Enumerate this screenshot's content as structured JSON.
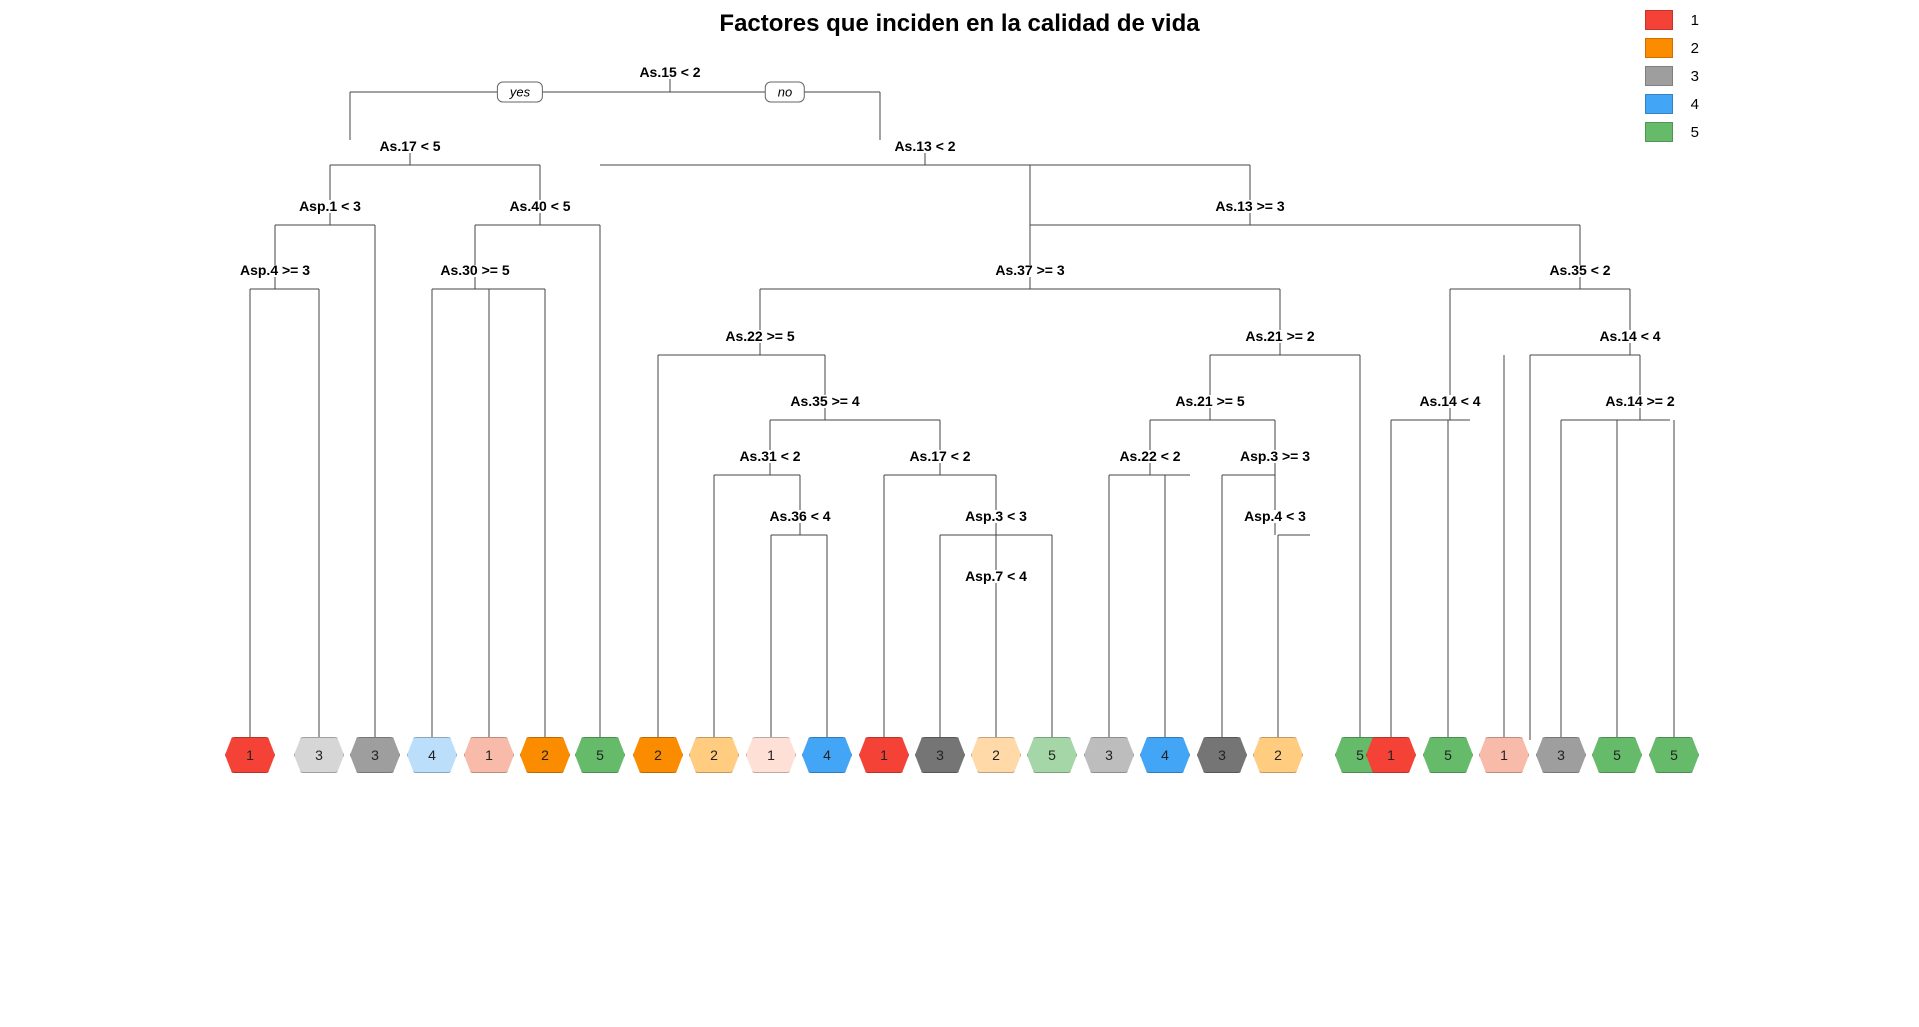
{
  "title": "Factores que inciden en la calidad de vida",
  "yes_label": "yes",
  "no_label": "no",
  "chart_data": {
    "type": "tree",
    "title": "Factores que inciden en la calidad de vida",
    "legend": [
      {
        "label": "1",
        "color": "#F44336"
      },
      {
        "label": "2",
        "color": "#FB8C00"
      },
      {
        "label": "3",
        "color": "#9E9E9E"
      },
      {
        "label": "4",
        "color": "#42A5F5"
      },
      {
        "label": "5",
        "color": "#66BB6A"
      }
    ],
    "nodes": [
      {
        "id": "root",
        "cond": "As.15 < 2"
      },
      {
        "id": "n_yes",
        "cond": "As.17 < 5"
      },
      {
        "id": "n_no",
        "cond": "As.13 < 2"
      },
      {
        "id": "n_asp1",
        "cond": "Asp.1 < 3"
      },
      {
        "id": "n_as40",
        "cond": "As.40 < 5"
      },
      {
        "id": "n_asp4",
        "cond": "Asp.4 >= 3"
      },
      {
        "id": "n_as30",
        "cond": "As.30 >= 5"
      },
      {
        "id": "n_as37",
        "cond": "As.37 >= 3"
      },
      {
        "id": "n_as13b",
        "cond": "As.13 >= 3"
      },
      {
        "id": "n_as22",
        "cond": "As.22 >= 5"
      },
      {
        "id": "n_as21",
        "cond": "As.21 >= 2"
      },
      {
        "id": "n_as35",
        "cond": "As.35 < 2"
      },
      {
        "id": "n_as35b",
        "cond": "As.35 >= 4"
      },
      {
        "id": "n_as21b",
        "cond": "As.21 >= 5"
      },
      {
        "id": "n_as14",
        "cond": "As.14 < 4"
      },
      {
        "id": "n_as14b",
        "cond": "As.14 < 4"
      },
      {
        "id": "n_as31",
        "cond": "As.31 < 2"
      },
      {
        "id": "n_as17b",
        "cond": "As.17 < 2"
      },
      {
        "id": "n_as22b",
        "cond": "As.22 < 2"
      },
      {
        "id": "n_asp3b",
        "cond": "Asp.3 >= 3"
      },
      {
        "id": "n_as14c",
        "cond": "As.14 >= 2"
      },
      {
        "id": "n_as36",
        "cond": "As.36 < 4"
      },
      {
        "id": "n_asp3",
        "cond": "Asp.3 < 3"
      },
      {
        "id": "n_asp4b",
        "cond": "Asp.4 < 3"
      },
      {
        "id": "n_asp7",
        "cond": "Asp.7 < 4"
      }
    ],
    "leaves": [
      {
        "class": "1",
        "color": "#F44336"
      },
      {
        "class": "3",
        "color": "#D6D6D6"
      },
      {
        "class": "3",
        "color": "#9E9E9E"
      },
      {
        "class": "4",
        "color": "#BBDEFB"
      },
      {
        "class": "1",
        "color": "#F8BBAA"
      },
      {
        "class": "2",
        "color": "#FB8C00"
      },
      {
        "class": "5",
        "color": "#66BB6A"
      },
      {
        "class": "2",
        "color": "#FB8C00"
      },
      {
        "class": "2",
        "color": "#FFCC80"
      },
      {
        "class": "1",
        "color": "#FFE0D6"
      },
      {
        "class": "4",
        "color": "#42A5F5"
      },
      {
        "class": "1",
        "color": "#F44336"
      },
      {
        "class": "3",
        "color": "#757575"
      },
      {
        "class": "2",
        "color": "#FFD9A8"
      },
      {
        "class": "5",
        "color": "#A5D6A7"
      },
      {
        "class": "3",
        "color": "#BDBDBD"
      },
      {
        "class": "4",
        "color": "#42A5F5"
      },
      {
        "class": "3",
        "color": "#757575"
      },
      {
        "class": "2",
        "color": "#FFCC80"
      },
      {
        "class": "5",
        "color": "#66BB6A"
      },
      {
        "class": "1",
        "color": "#F44336"
      },
      {
        "class": "5",
        "color": "#66BB6A"
      },
      {
        "class": "1",
        "color": "#F8BBAA"
      },
      {
        "class": "3",
        "color": "#9E9E9E"
      },
      {
        "class": "5",
        "color": "#66BB6A"
      },
      {
        "class": "5",
        "color": "#66BB6A"
      }
    ]
  }
}
